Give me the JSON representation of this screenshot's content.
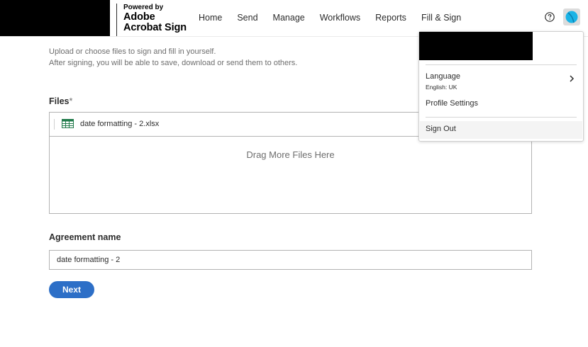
{
  "brand": {
    "powered_by": "Powered by",
    "name_line1": "Adobe",
    "name_line2": "Acrobat Sign"
  },
  "nav": {
    "items": [
      {
        "label": "Home"
      },
      {
        "label": "Send"
      },
      {
        "label": "Manage"
      },
      {
        "label": "Workflows"
      },
      {
        "label": "Reports"
      },
      {
        "label": "Fill & Sign",
        "active": true
      }
    ]
  },
  "icons": {
    "help": "help-circle-icon",
    "avatar": "user-avatar-icon",
    "file": "spreadsheet-file-icon",
    "submenu": "chevron-right-icon"
  },
  "intro": {
    "line1": "Upload or choose files to sign and fill in yourself.",
    "line2": "After signing, you will be able to save, download or send them to others."
  },
  "files": {
    "label": "Files",
    "required_mark": "*",
    "items": [
      {
        "name": "date formatting - 2.xlsx"
      }
    ],
    "drop_text": "Drag More Files Here"
  },
  "agreement": {
    "label": "Agreement name",
    "value": "date formatting - 2"
  },
  "next_button": "Next",
  "user_menu": {
    "language_label": "Language",
    "language_value": "English: UK",
    "profile_settings": "Profile Settings",
    "sign_out": "Sign Out"
  },
  "colors": {
    "accent": "#2d6fc7",
    "avatar": "#1ab3e6",
    "excel_green": "#1f7a4a"
  }
}
